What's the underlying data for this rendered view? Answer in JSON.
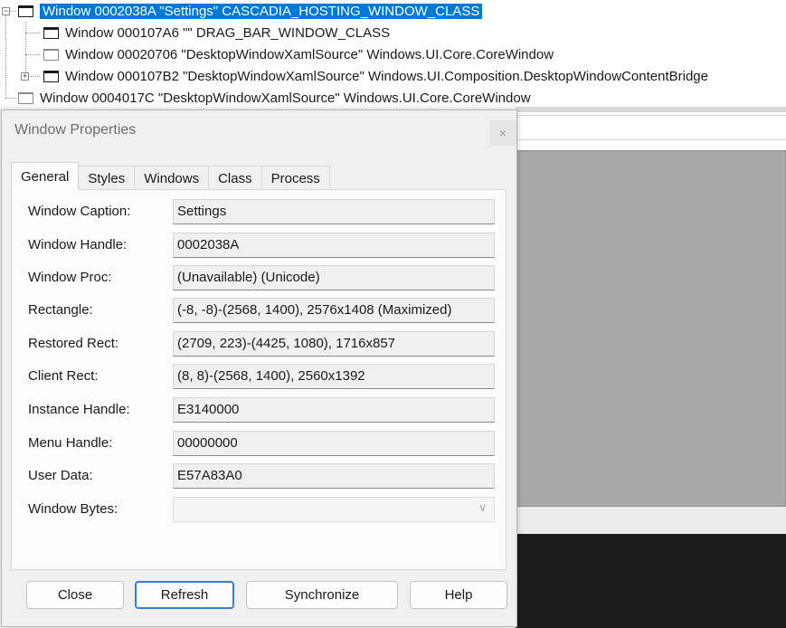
{
  "tree": {
    "rows": [
      {
        "label": "Window 0002038A \"Settings\" CASCADIA_HOSTING_WINDOW_CLASS"
      },
      {
        "label": "Window 000107A6 \"\" DRAG_BAR_WINDOW_CLASS"
      },
      {
        "label": "Window 00020706 \"DesktopWindowXamlSource\" Windows.UI.Core.CoreWindow"
      },
      {
        "label": "Window 000107B2 \"DesktopWindowXamlSource\" Windows.UI.Composition.DesktopWindowContentBridge"
      },
      {
        "label": "Window 0004017C \"DesktopWindowXamlSource\" Windows.UI.Core.CoreWindow"
      }
    ],
    "expander_minus": "−",
    "expander_plus": "+"
  },
  "dialog": {
    "title": "Window Properties",
    "close_glyph": "×",
    "tabs": [
      {
        "label": "General"
      },
      {
        "label": "Styles"
      },
      {
        "label": "Windows"
      },
      {
        "label": "Class"
      },
      {
        "label": "Process"
      }
    ],
    "active_tab": "General",
    "fields": [
      {
        "label": "Window Caption:",
        "value": "Settings"
      },
      {
        "label": "Window Handle:",
        "value": "0002038A"
      },
      {
        "label": "Window Proc:",
        "value": "(Unavailable) (Unicode)"
      },
      {
        "label": "Rectangle:",
        "value": "(-8, -8)-(2568, 1400), 2576x1408 (Maximized)"
      },
      {
        "label": "Restored Rect:",
        "value": "(2709, 223)-(4425, 1080), 1716x857"
      },
      {
        "label": "Client Rect:",
        "value": "(8, 8)-(2568, 1400), 2560x1392"
      },
      {
        "label": "Instance Handle:",
        "value": "E3140000"
      },
      {
        "label": "Menu Handle:",
        "value": "00000000"
      },
      {
        "label": "User Data:",
        "value": "E57A83A0"
      },
      {
        "label": "Window Bytes:",
        "value": ""
      }
    ],
    "buttons": {
      "close": "Close",
      "refresh": "Refresh",
      "synchronize": "Synchronize",
      "help": "Help"
    }
  },
  "colors": {
    "selection": "#0078d7",
    "default_button_border": "#3c7bd8"
  },
  "icons": {
    "window": "window-icon",
    "chevron": "chevron-down-icon",
    "close": "close-icon"
  }
}
